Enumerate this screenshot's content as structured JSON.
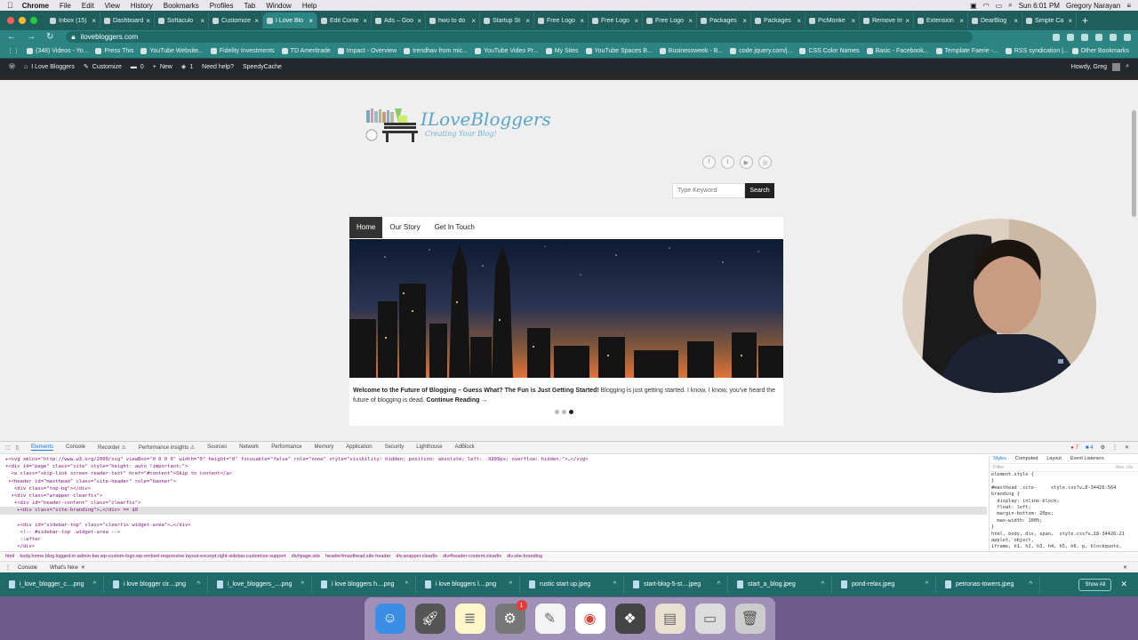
{
  "menubar": {
    "app": "Chrome",
    "items": [
      "File",
      "Edit",
      "View",
      "History",
      "Bookmarks",
      "Profiles",
      "Tab",
      "Window",
      "Help"
    ],
    "clock": "Sun 6:01 PM",
    "user": "Gregory Narayan"
  },
  "tabs": [
    {
      "label": "Inbox (15)",
      "active": false
    },
    {
      "label": "Dashboard",
      "active": false
    },
    {
      "label": "Softaculo",
      "active": false
    },
    {
      "label": "Customize",
      "active": false
    },
    {
      "label": "I Love Blo",
      "active": true
    },
    {
      "label": "Edit Conte",
      "active": false
    },
    {
      "label": "Ads – Goo",
      "active": false
    },
    {
      "label": "hwo to do",
      "active": false
    },
    {
      "label": "Startup St",
      "active": false
    },
    {
      "label": "Free Logo",
      "active": false
    },
    {
      "label": "Free Logo",
      "active": false
    },
    {
      "label": "Free Logo",
      "active": false
    },
    {
      "label": "Packages",
      "active": false
    },
    {
      "label": "Packages",
      "active": false
    },
    {
      "label": "PicMonke",
      "active": false
    },
    {
      "label": "Remove Im",
      "active": false
    },
    {
      "label": "Extension",
      "active": false
    },
    {
      "label": "DearBlog",
      "active": false
    },
    {
      "label": "Simple Ca",
      "active": false
    }
  ],
  "address": {
    "url": "ilovebloggers.com"
  },
  "bookmarks": [
    "(348) Videos - Yo...",
    "Press This",
    "YouTube Website...",
    "Fidelity Investments",
    "TD Ameritrade",
    "Impact - Overview",
    "trendhav from mic...",
    "YouTube Video Pr...",
    "My Sites",
    "YouTube Spaces B...",
    "Businessweek - B...",
    "code.jquery.com/j...",
    "CSS Color Names",
    "Basic - Facebook...",
    "Template Faerie -...",
    "RSS syndication |..."
  ],
  "bookmarks_other": "Other Bookmarks",
  "wpbar": {
    "site": "I Love Bloggers",
    "customize": "Customize",
    "comments": "0",
    "new": "New",
    "updates": "1",
    "help": "Need help?",
    "cache": "SpeedyCache",
    "howdy": "Howdy, Greg"
  },
  "site": {
    "logo_name": "ILoveBloggers",
    "logo_tagline": "Creating Your Blog!",
    "search_placeholder": "Type Keyword",
    "search_button": "Search",
    "nav": [
      {
        "label": "Home",
        "active": true
      },
      {
        "label": "Our Story",
        "active": false
      },
      {
        "label": "Get In Touch",
        "active": false
      }
    ],
    "caption_title": "Welcome to the Future of Blogging – Guess What? The Fun is Just Getting Started!",
    "caption_text": " Blogging is just getting started. I know, I know, you've heard the future of blogging is dead. ",
    "caption_link": "Continue Reading →",
    "slider_active_index": 2
  },
  "devtools": {
    "tabs": [
      "Elements",
      "Console",
      "Recorder ⚠",
      "Performance insights ⚠",
      "Sources",
      "Network",
      "Performance",
      "Memory",
      "Application",
      "Security",
      "Lighthouse",
      "AdBlock"
    ],
    "active_tab": "Elements",
    "errors": "7",
    "warnings": "4",
    "dom": [
      "▸<svg xmlns=\"http://www.w3.org/2000/svg\" viewBox=\"0 0 0 0\" width=\"0\" height=\"0\" focusable=\"false\" role=\"none\" style=\"visibility: hidden; position: absolute; left: -9999px; overflow: hidden;\">…</svg>",
      "▾<div id=\"page\" class=\"site\" style=\"height: auto !important;\">",
      "  <a class=\"skip-link screen-reader-text\" href=\"#content\">Skip to content</a>",
      " ▾<header id=\"masthead\" class=\"site-header\" role=\"banner\">",
      "   <div class=\"top-bg\"></div>",
      "  ▾<div class=\"wrapper clearfix\">",
      "   ▾<div id=\"header-content\" class=\"clearfix\">",
      "    ▸<div class=\"site-branding\">…</div> == $0",
      "",
      "    ▸<div id=\"sidebar-top\" class=\"clearfix widget-area\">…</div>",
      "     <!-- #sidebar-top .widget-area -->",
      "     ::after",
      "    </div>"
    ],
    "selected_row": 7,
    "styles_tabs": [
      "Styles",
      "Computed",
      "Layout",
      "Event Listeners"
    ],
    "filter": "Filter",
    "filter_opts": ":hov .cls",
    "styles": [
      "element.style {",
      "}",
      "#masthead .site-     style.css?v…8-34426:564",
      "branding {",
      "  display: inline-block;",
      "  float: left;",
      "  margin-bottom: 20px;",
      "  max-width: 100%;",
      "}",
      "html, body, div, span,  style.css?v…18-34426:21",
      "applet, object,",
      "iframe, h1, h2, h3, h4, h5, h6, p, blockquote,"
    ],
    "crumbs": [
      "html",
      "body.home.blog.logged-in.admin-bar.wp-custom-logo.wp-embed-responsive.layout-excerpt.right-sidebar.customize-support",
      "div#page.site",
      "header#masthead.site-header",
      "div.wrapper.clearfix",
      "div#header-content.clearfix",
      "div.site-branding"
    ],
    "drawer_tabs": [
      "Console",
      "What's New"
    ]
  },
  "downloads": {
    "items": [
      "i_love_blogger_c....png",
      "i love blogger cir....png",
      "i_love_bloggers_....png",
      "i love bloggers h....png",
      "i love bloggers l....png",
      "rustic start up.jpeg",
      "start-blog-5-st....jpeg",
      "start_a_blog.jpeg",
      "pond-relax.jpeg",
      "petronas-towers.jpeg"
    ],
    "show_all": "Show All"
  },
  "dock": {
    "settings_badge": "1"
  },
  "colors": {
    "accent": "#2d8583",
    "tabbar": "#1f5e5d",
    "wpbar": "#23282d",
    "logo": "#5aa6c8"
  }
}
